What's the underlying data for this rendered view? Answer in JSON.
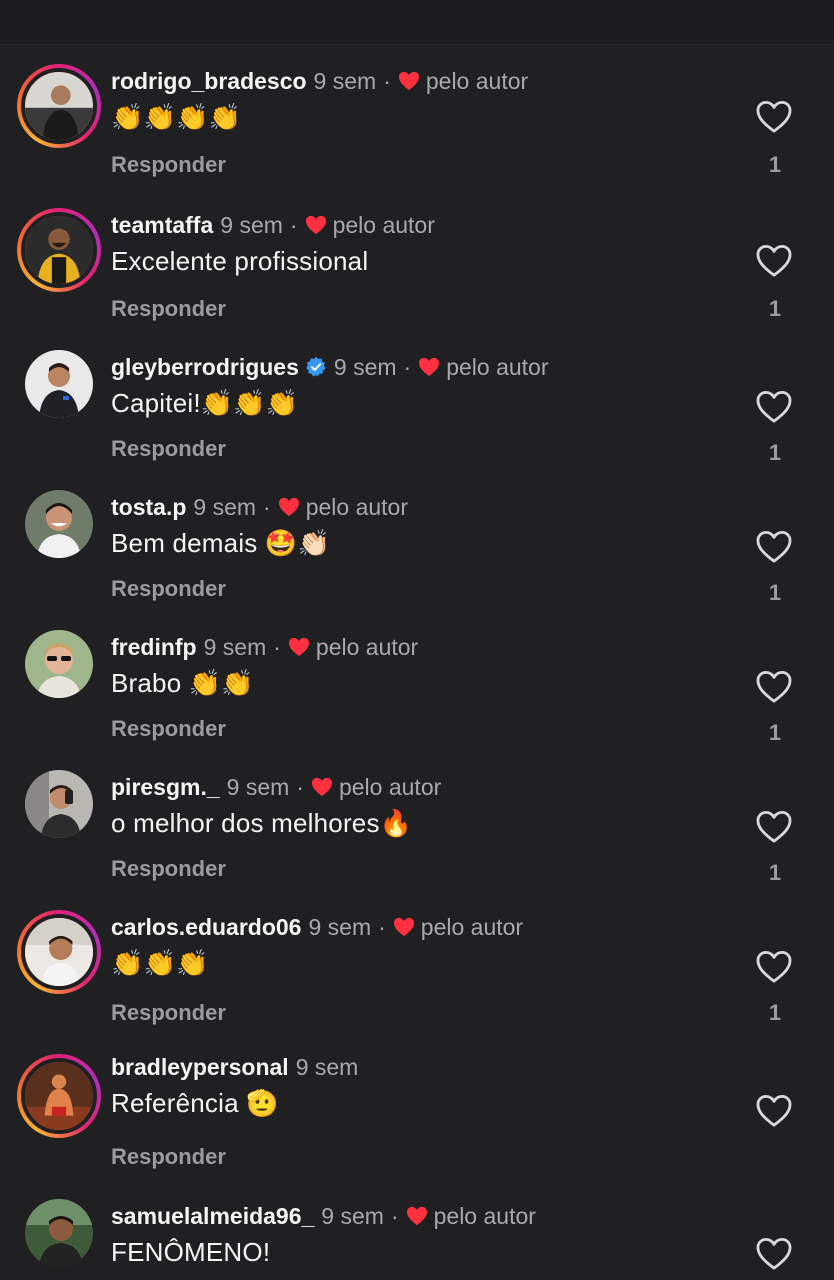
{
  "reply_label": "Responder",
  "by_author_label": "pelo autor",
  "colors": {
    "background": "#202023",
    "heart_red": "#ff3040",
    "muted": "#a8a8ae",
    "verified_blue": "#3897f0"
  },
  "comments": [
    {
      "username": "rodrigo_bradesco",
      "time": "9 sem",
      "text": "👏👏👏👏",
      "likes": "1",
      "liked_by_author": true,
      "story_ring": true,
      "verified": false
    },
    {
      "username": "teamtaffa",
      "time": "9 sem",
      "text": "Excelente profissional",
      "likes": "1",
      "liked_by_author": true,
      "story_ring": true,
      "verified": false
    },
    {
      "username": "gleyberrodrigues",
      "time": "9 sem",
      "text": "Capitei!👏👏👏",
      "likes": "1",
      "liked_by_author": true,
      "story_ring": false,
      "verified": true
    },
    {
      "username": "tosta.p",
      "time": "9 sem",
      "text": "Bem demais 🤩👏🏻",
      "likes": "1",
      "liked_by_author": true,
      "story_ring": false,
      "verified": false
    },
    {
      "username": "fredinfp",
      "time": "9 sem",
      "text": "Brabo 👏👏",
      "likes": "1",
      "liked_by_author": true,
      "story_ring": false,
      "verified": false
    },
    {
      "username": "piresgm._",
      "time": "9 sem",
      "text": "o melhor dos melhores🔥",
      "likes": "1",
      "liked_by_author": true,
      "story_ring": false,
      "verified": false
    },
    {
      "username": "carlos.eduardo06",
      "time": "9 sem",
      "text": "👏👏👏",
      "likes": "1",
      "liked_by_author": true,
      "story_ring": true,
      "verified": false
    },
    {
      "username": "bradleypersonal",
      "time": "9 sem",
      "text": "Referência 🫡",
      "likes": "",
      "liked_by_author": false,
      "story_ring": true,
      "verified": false
    },
    {
      "username": "samuelalmeida96_",
      "time": "9 sem",
      "text": "FENÔMENO!",
      "likes": "",
      "liked_by_author": true,
      "story_ring": false,
      "verified": false
    }
  ]
}
